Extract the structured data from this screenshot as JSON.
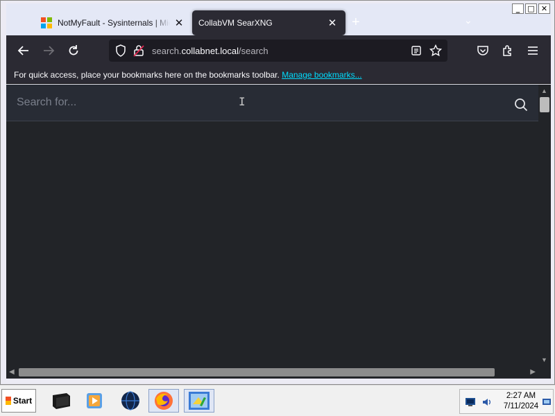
{
  "window": {
    "controls": [
      "_",
      "□",
      "✕"
    ]
  },
  "tabs": [
    {
      "title": "NotMyFault - Sysinternals | Microsoft Learn",
      "close": "✕",
      "active": false
    },
    {
      "title": "CollabVM SearXNG",
      "close": "✕",
      "active": true
    }
  ],
  "tabstrip": {
    "new_tab": "+",
    "list_all": "⌄"
  },
  "urlbar": {
    "prefix": "search.",
    "host": "collabnet.local",
    "path": "/search"
  },
  "bookmarks": {
    "message": "For quick access, place your bookmarks here on the bookmarks toolbar.",
    "link": "Manage bookmarks..."
  },
  "search": {
    "placeholder": "Search for..."
  },
  "taskbar": {
    "start_label": "Start",
    "clock_time": "2:27 AM",
    "clock_date": "7/11/2024",
    "apps": [
      "terminal-app",
      "media-player-app",
      "network-globe-app",
      "firefox-app",
      "control-panel-app"
    ]
  },
  "colors": {
    "toolbar_bg": "#2b2a33",
    "content_bg": "#222428",
    "searchbar_bg": "#282c35",
    "link": "#00ddff",
    "tabstrip_bg": "#e4e8f6"
  }
}
